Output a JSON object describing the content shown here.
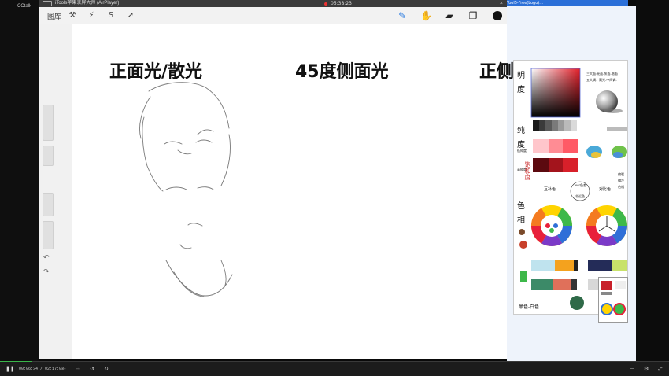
{
  "cctalk": {
    "brand": "CCtalk"
  },
  "airplayer": {
    "title": "iTools苹果录屏大师 (AirPlayer)",
    "record_time": "05:38:23",
    "close": "×"
  },
  "procreate": {
    "gallery_label": "图库",
    "tools_left": [
      {
        "icon": "wrench-icon",
        "glyph": "⚒"
      },
      {
        "icon": "magic-wand-icon",
        "glyph": "⚡"
      },
      {
        "icon": "selection-icon",
        "glyph": "S"
      },
      {
        "icon": "transform-icon",
        "glyph": "➚"
      }
    ],
    "tools_right": [
      {
        "icon": "brush-icon",
        "glyph": "✎"
      },
      {
        "icon": "smudge-icon",
        "glyph": "✋"
      },
      {
        "icon": "eraser-icon",
        "glyph": "▰"
      },
      {
        "icon": "layers-icon",
        "glyph": "❐"
      }
    ],
    "current_color": "#111111",
    "undo_glyph": "↶",
    "redo_glyph": "↷",
    "headings": [
      "正面光/散光",
      "45度侧面光",
      "正侧"
    ]
  },
  "reference": {
    "left_labels": [
      "明",
      "度",
      "纯",
      "度",
      "色",
      "相"
    ],
    "note_top_1": "三大面:亮面-灰面-暗面",
    "note_top_2": "五大调：高光-中间调-",
    "complement_label": "互补色",
    "contrast_label": "对比色",
    "bottom_label": "黑色-白色",
    "ring_note_1": "60°色差",
    "ring_note_2": "邻近色",
    "side_notes": [
      "低纯度",
      "高纯度"
    ],
    "red_note": "饱和度",
    "vert_note": [
      "偏暖",
      "偏冷",
      "色相"
    ]
  },
  "right_app": {
    "title_fragment": "Tool5-Free(Logo)..."
  },
  "player": {
    "time": "00:06:34 / 02:17:03",
    "progress": 0.048,
    "accent": "#3ab54a"
  }
}
